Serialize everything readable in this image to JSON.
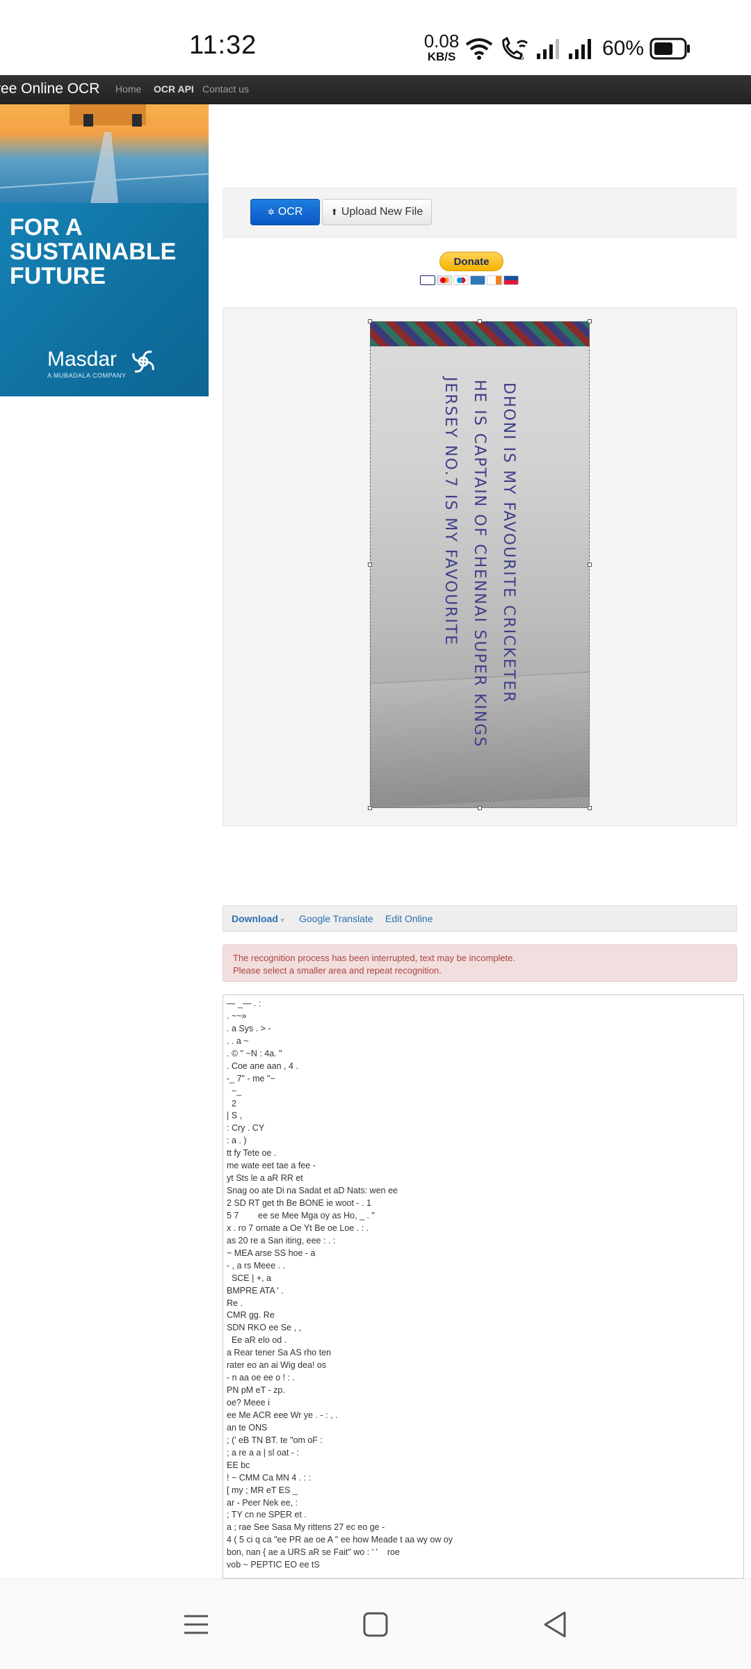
{
  "status_bar": {
    "time": "11:32",
    "net_speed_value": "0.08",
    "net_speed_unit": "KB/S",
    "battery_percent": "60%",
    "icons": [
      "wifi-icon",
      "wifi-calling-icon",
      "signal-1-icon",
      "signal-2-icon",
      "battery-icon"
    ]
  },
  "navbar": {
    "brand": "ree Online OCR",
    "links": [
      "Home",
      "OCR API",
      "Contact us"
    ],
    "active": "OCR API"
  },
  "ad": {
    "headline": "FOR A SUSTAINABLE FUTURE",
    "brand": "Masdar",
    "subtitle": "A MUBADALA COMPANY"
  },
  "toolbar": {
    "ocr_label": "OCR",
    "upload_label": "Upload New File"
  },
  "donate": {
    "label": "Donate",
    "cards": [
      "visa",
      "mastercard",
      "maestro",
      "amex",
      "discover",
      "paypal"
    ]
  },
  "image": {
    "handwriting": [
      "DHONI IS MY FAVOURITE CRICKETER",
      "HE IS CAPTAIN OF CHENNAI SUPER KINGS",
      "JERSEY NO.7 IS MY FAVOURITE"
    ]
  },
  "result_toolbar": {
    "download": "Download",
    "translate": "Google Translate",
    "edit": "Edit Online"
  },
  "alert": {
    "line1": "The recognition process has been interrupted, text may be incomplete.",
    "line2": "Please select a smaller area and repeat recognition."
  },
  "result_lines": [
    "— _— . :",
    ". ~~»",
    ". a Sys . > -",
    ". . a ~",
    ". © \" ~N : 4a. \"",
    ". Coe ane aan , 4 .",
    "-_ 7\" - me \"~",
    "  ~_",
    "  2",
    "| S ,",
    ": Cry . CY",
    ": a . )",
    "tt fy Tete oe .",
    "me wate eet tae a fee -",
    "yt Sts le a aR RR et",
    "Snag oo ate Di na Sadat et aD Nats: wen ee",
    "2 SD RT get th Be BONE ie woot - . 1",
    "5 7        ee se Mee Mga oy as Ho, _ . \"",
    "x . ro 7 ornate a Oe Yt Be oe Loe . : .",
    "as 20 re a San iting, eee : . :",
    "~ MEA arse SS hoe - a",
    "- , a rs Meee . .",
    "  SCE | +, a",
    "BMPRE ATA ' .",
    "Re .",
    "CMR gg. Re",
    "SDN RKO ee Se , ,",
    "  Ee aR elo od .",
    "a Rear tener Sa AS rho ten",
    "rater eo an ai Wig dea! os",
    "- n aa oe ee o ! : .",
    "PN pM eT - zp.",
    "oe? Meee i",
    "ee Me ACR eee Wr ye . - : , .",
    "an te ONS",
    "; (' eB TN BT. te \"om oF :",
    "; a re a a | sl oat - :",
    "EE bc",
    "! ~ CMM Ca MN 4 . : :",
    "[ my ; MR eT ES _",
    "ar - Peer Nek ee, :",
    "; TY cn ne SPER et .",
    "a ; rae See Sasa My rittens 27 ec eo ge -",
    "4 ( 5 ci q ca \"ee PR ae oe A \" ee how Meade t aa wy ow oy",
    "bon, nan { ae a URS aR se Fait\" wo : ' '    roe",
    "vob ~ PEPTIC EO ee tS"
  ],
  "nav_bar": [
    "menu-icon",
    "home-icon",
    "back-icon"
  ]
}
